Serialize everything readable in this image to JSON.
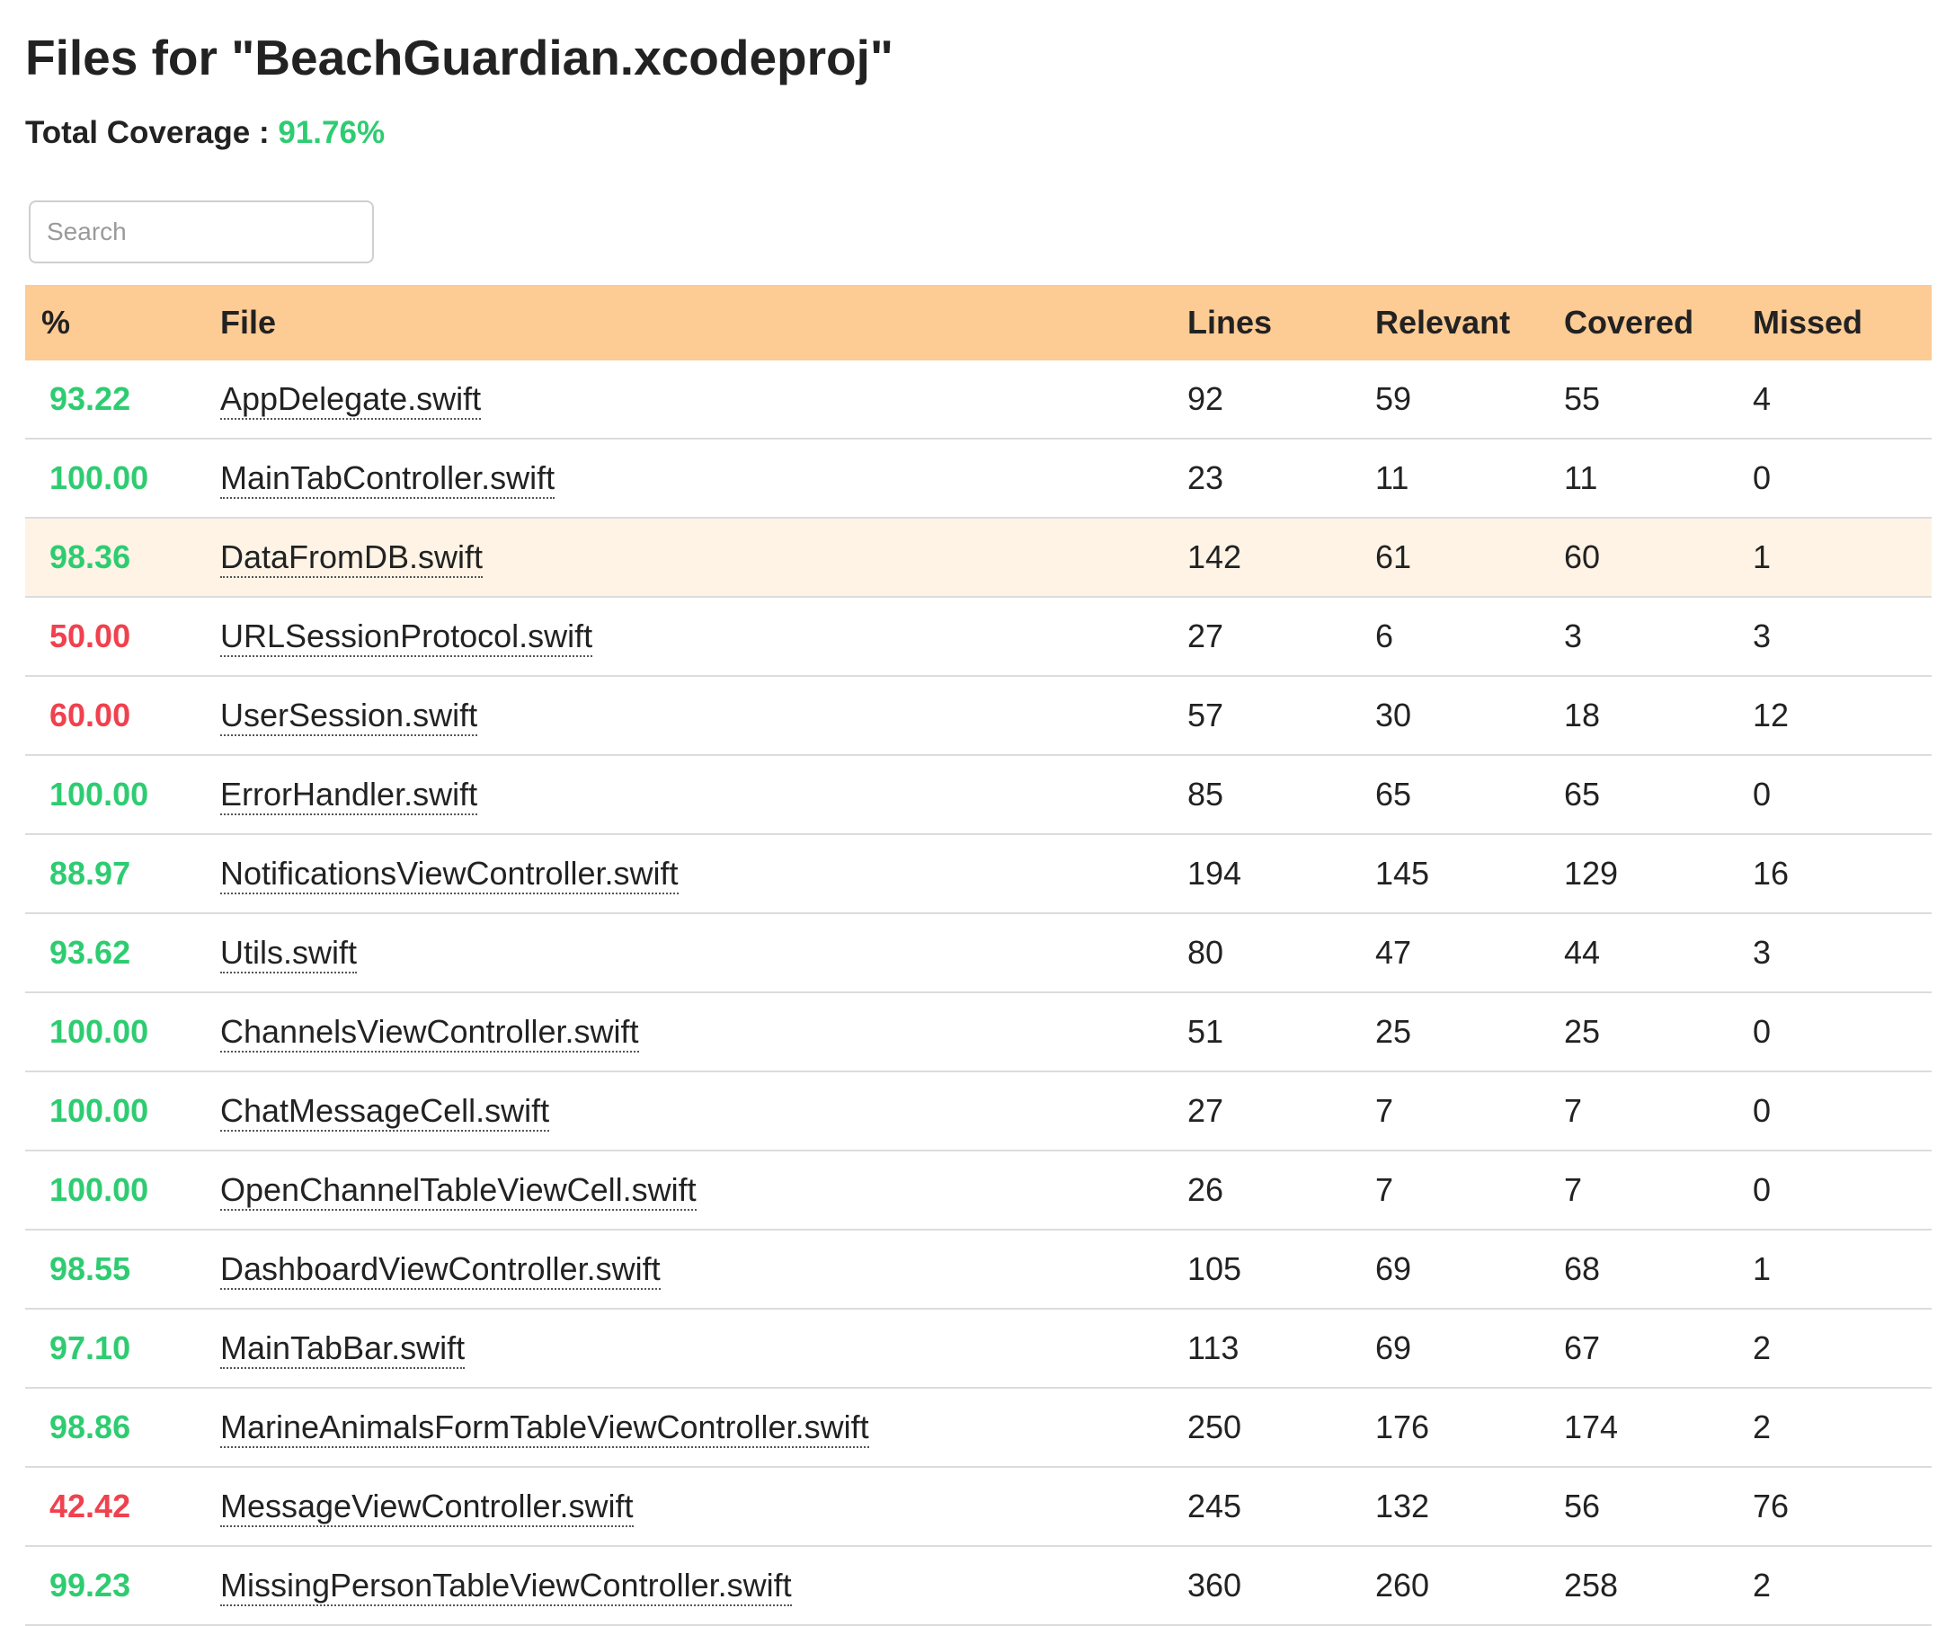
{
  "header": {
    "title": "Files for \"BeachGuardian.xcodeproj\"",
    "total_label": "Total Coverage : ",
    "total_value": "91.76%"
  },
  "search": {
    "placeholder": "Search",
    "value": ""
  },
  "colors": {
    "header_bg": "#fdcb94",
    "highlight_row_bg": "#fef3e5",
    "good": "#2ecc71",
    "bad": "#f0414e"
  },
  "table": {
    "columns": [
      "%",
      "File",
      "Lines",
      "Relevant",
      "Covered",
      "Missed"
    ],
    "highlighted_row": 2,
    "rows": [
      {
        "pct": "93.22",
        "status": "good",
        "file": "AppDelegate.swift",
        "lines": "92",
        "relevant": "59",
        "covered": "55",
        "missed": "4"
      },
      {
        "pct": "100.00",
        "status": "good",
        "file": "MainTabController.swift",
        "lines": "23",
        "relevant": "11",
        "covered": "11",
        "missed": "0"
      },
      {
        "pct": "98.36",
        "status": "good",
        "file": "DataFromDB.swift",
        "lines": "142",
        "relevant": "61",
        "covered": "60",
        "missed": "1"
      },
      {
        "pct": "50.00",
        "status": "bad",
        "file": "URLSessionProtocol.swift",
        "lines": "27",
        "relevant": "6",
        "covered": "3",
        "missed": "3"
      },
      {
        "pct": "60.00",
        "status": "bad",
        "file": "UserSession.swift",
        "lines": "57",
        "relevant": "30",
        "covered": "18",
        "missed": "12"
      },
      {
        "pct": "100.00",
        "status": "good",
        "file": "ErrorHandler.swift",
        "lines": "85",
        "relevant": "65",
        "covered": "65",
        "missed": "0"
      },
      {
        "pct": "88.97",
        "status": "good",
        "file": "NotificationsViewController.swift",
        "lines": "194",
        "relevant": "145",
        "covered": "129",
        "missed": "16"
      },
      {
        "pct": "93.62",
        "status": "good",
        "file": "Utils.swift",
        "lines": "80",
        "relevant": "47",
        "covered": "44",
        "missed": "3"
      },
      {
        "pct": "100.00",
        "status": "good",
        "file": "ChannelsViewController.swift",
        "lines": "51",
        "relevant": "25",
        "covered": "25",
        "missed": "0"
      },
      {
        "pct": "100.00",
        "status": "good",
        "file": "ChatMessageCell.swift",
        "lines": "27",
        "relevant": "7",
        "covered": "7",
        "missed": "0"
      },
      {
        "pct": "100.00",
        "status": "good",
        "file": "OpenChannelTableViewCell.swift",
        "lines": "26",
        "relevant": "7",
        "covered": "7",
        "missed": "0"
      },
      {
        "pct": "98.55",
        "status": "good",
        "file": "DashboardViewController.swift",
        "lines": "105",
        "relevant": "69",
        "covered": "68",
        "missed": "1"
      },
      {
        "pct": "97.10",
        "status": "good",
        "file": "MainTabBar.swift",
        "lines": "113",
        "relevant": "69",
        "covered": "67",
        "missed": "2"
      },
      {
        "pct": "98.86",
        "status": "good",
        "file": "MarineAnimalsFormTableViewController.swift",
        "lines": "250",
        "relevant": "176",
        "covered": "174",
        "missed": "2"
      },
      {
        "pct": "42.42",
        "status": "bad",
        "file": "MessageViewController.swift",
        "lines": "245",
        "relevant": "132",
        "covered": "56",
        "missed": "76"
      },
      {
        "pct": "99.23",
        "status": "good",
        "file": "MissingPersonTableViewController.swift",
        "lines": "360",
        "relevant": "260",
        "covered": "258",
        "missed": "2"
      }
    ]
  }
}
